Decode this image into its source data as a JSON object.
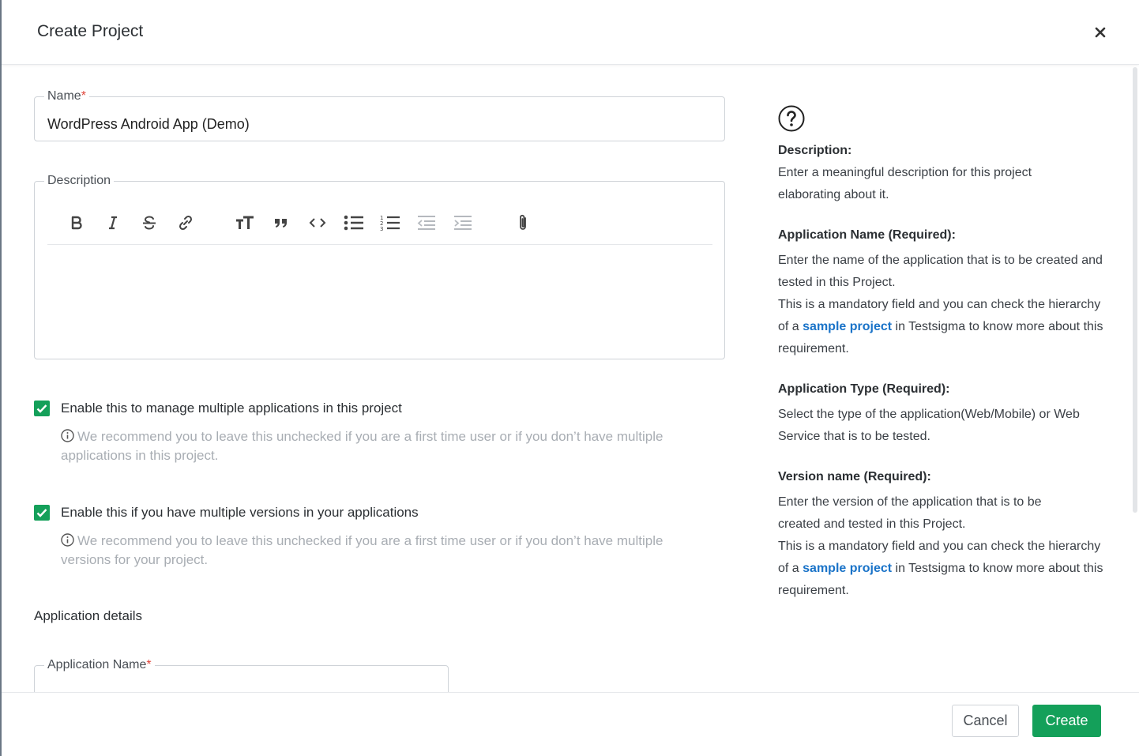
{
  "dialog": {
    "title": "Create Project",
    "close_icon": "close-icon"
  },
  "form": {
    "name": {
      "label": "Name",
      "required_mark": "*",
      "value": "WordPress Android App (Demo)"
    },
    "description": {
      "label": "Description",
      "toolbar": [
        {
          "icon": "bold-icon",
          "enabled": true
        },
        {
          "icon": "italic-icon",
          "enabled": true
        },
        {
          "icon": "strikethrough-icon",
          "enabled": true
        },
        {
          "icon": "link-icon",
          "enabled": true
        },
        {
          "icon": "heading-icon",
          "enabled": true
        },
        {
          "icon": "quote-icon",
          "enabled": true
        },
        {
          "icon": "code-icon",
          "enabled": true
        },
        {
          "icon": "bullet-list-icon",
          "enabled": true
        },
        {
          "icon": "numbered-list-icon",
          "enabled": true
        },
        {
          "icon": "outdent-icon",
          "enabled": false
        },
        {
          "icon": "indent-icon",
          "enabled": false
        },
        {
          "icon": "attachment-icon",
          "enabled": true
        }
      ],
      "value": ""
    },
    "multi_app": {
      "checked": true,
      "label": "Enable this to manage multiple applications in this project",
      "hint": "We recommend you to leave this unchecked if you are a first time user or if you don’t have multiple applications in this project."
    },
    "multi_version": {
      "checked": true,
      "label": "Enable this if you have multiple versions in your applications",
      "hint": "We recommend you to leave this unchecked if you are a first time user or if you don’t have multiple versions for your project."
    },
    "application_details": {
      "title": "Application details",
      "app_name_label": "Application Name",
      "required_mark": "*"
    }
  },
  "help": {
    "icon": "question-circle-icon",
    "description": {
      "heading": "Description:",
      "text": "Enter a meaningful description for this project elaborating about it."
    },
    "application_name": {
      "heading": "Application Name (Required):",
      "text1": "Enter the name of the application that is to be created and tested in this Project.",
      "text2_pre": "This is a mandatory field and you can check the hierarchy of a ",
      "link": "sample project",
      "text2_post": " in Testsigma to know more about this requirement."
    },
    "application_type": {
      "heading": "Application Type (Required):",
      "text": "Select the type of the application(Web/Mobile) or Web Service that is to be tested."
    },
    "version_name": {
      "heading": "Version name (Required):",
      "text1": "Enter the version of the application that is to be created and tested in this Project.",
      "text2_pre": "This is a mandatory field and you can check the hierarchy of a ",
      "link": "sample project",
      "text2_post": " in Testsigma to know more about this requirement."
    }
  },
  "footer": {
    "cancel_label": "Cancel",
    "create_label": "Create"
  },
  "colors": {
    "accent_green": "#14a05a",
    "link_blue": "#1a73c8",
    "required_red": "#e0453a"
  }
}
